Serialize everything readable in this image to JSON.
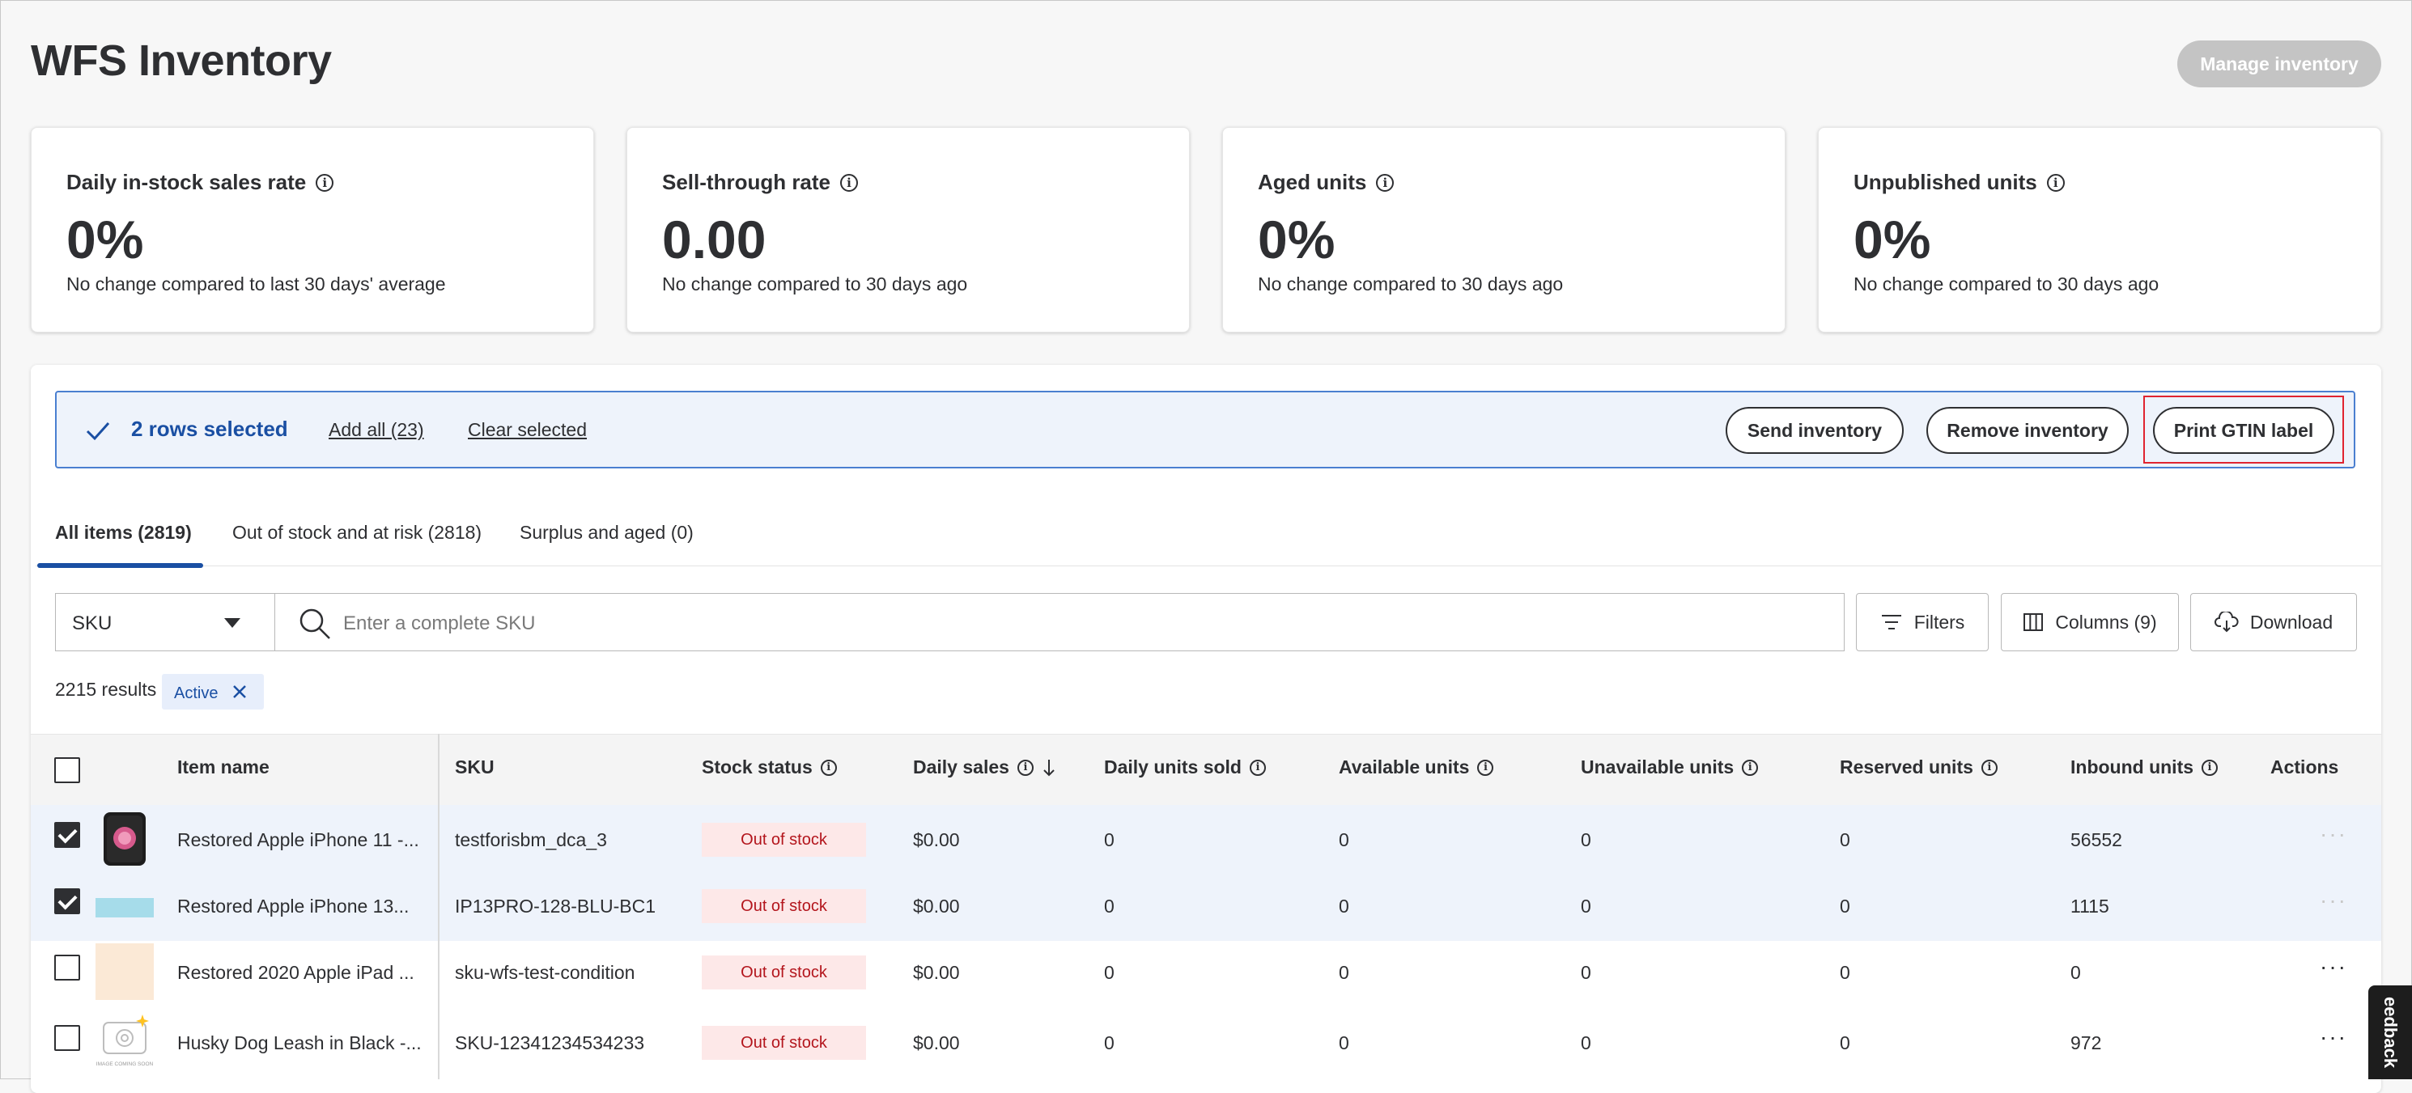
{
  "page": {
    "title": "WFS Inventory",
    "manage_btn": "Manage inventory"
  },
  "metrics": [
    {
      "title": "Daily in-stock sales rate",
      "value": "0%",
      "sub": "No change compared to last 30 days' average"
    },
    {
      "title": "Sell-through rate",
      "value": "0.00",
      "sub": "No change compared to 30 days ago"
    },
    {
      "title": "Aged units",
      "value": "0%",
      "sub": "No change compared to 30 days ago"
    },
    {
      "title": "Unpublished units",
      "value": "0%",
      "sub": "No change compared to 30 days ago"
    }
  ],
  "selection": {
    "count": "2 rows selected",
    "add_all": "Add all (23)",
    "clear": "Clear selected",
    "send": "Send inventory",
    "remove": "Remove inventory",
    "print": "Print GTIN label"
  },
  "tabs": [
    "All items (2819)",
    "Out of stock and at risk (2818)",
    "Surplus and aged (0)"
  ],
  "search": {
    "filter_type": "SKU",
    "placeholder": "Enter a complete SKU"
  },
  "toolbar": {
    "filters": "Filters",
    "columns": "Columns (9)",
    "download": "Download"
  },
  "results": {
    "count": "2215 results",
    "chip": "Active"
  },
  "table": {
    "headers": {
      "item_name": "Item name",
      "sku": "SKU",
      "stock_status": "Stock status",
      "daily_sales": "Daily sales",
      "daily_units_sold": "Daily units sold",
      "available": "Available units",
      "unavailable": "Unavailable units",
      "reserved": "Reserved units",
      "inbound": "Inbound units",
      "actions": "Actions"
    },
    "rows": [
      {
        "name": "Restored Apple iPhone 11 -...",
        "sku": "testforisbm_dca_3",
        "status": "Out of stock",
        "sales": "$0.00",
        "sold": "0",
        "available": "0",
        "unavailable": "0",
        "reserved": "0",
        "inbound": "56552",
        "checked": true
      },
      {
        "name": "Restored Apple iPhone 13...",
        "sku": "IP13PRO-128-BLU-BC1",
        "status": "Out of stock",
        "sales": "$0.00",
        "sold": "0",
        "available": "0",
        "unavailable": "0",
        "reserved": "0",
        "inbound": "1115",
        "checked": true
      },
      {
        "name": "Restored 2020 Apple iPad ...",
        "sku": "sku-wfs-test-condition",
        "status": "Out of stock",
        "sales": "$0.00",
        "sold": "0",
        "available": "0",
        "unavailable": "0",
        "reserved": "0",
        "inbound": "0",
        "checked": false
      },
      {
        "name": "Husky Dog Leash in Black -...",
        "sku": "SKU-12341234534233",
        "status": "Out of stock",
        "sales": "$0.00",
        "sold": "0",
        "available": "0",
        "unavailable": "0",
        "reserved": "0",
        "inbound": "972",
        "checked": false
      }
    ],
    "image_coming_soon": "IMAGE COMING SOON"
  },
  "feedback": "eedback",
  "colors": {
    "accent": "#1a4fa3",
    "selection_bg": "#eef3fb",
    "badge_bg": "#fde8e8",
    "badge_text": "#b3151c"
  }
}
